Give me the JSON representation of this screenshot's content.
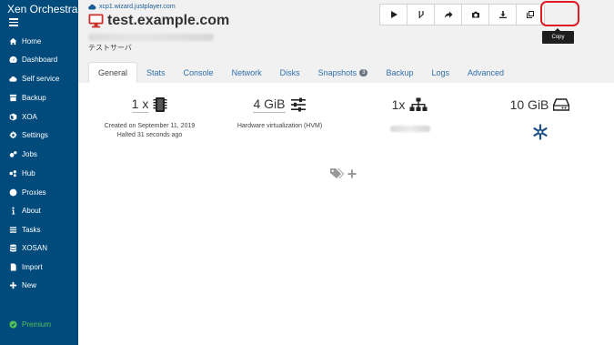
{
  "sidebar": {
    "brand": "Xen Orchestra",
    "items": [
      {
        "label": "Home",
        "icon": "home-icon"
      },
      {
        "label": "Dashboard",
        "icon": "dashboard-icon"
      },
      {
        "label": "Self service",
        "icon": "cloud-icon"
      },
      {
        "label": "Backup",
        "icon": "backup-icon"
      },
      {
        "label": "XOA",
        "icon": "cube-icon"
      },
      {
        "label": "Settings",
        "icon": "cog-icon"
      },
      {
        "label": "Jobs",
        "icon": "cogs-icon"
      },
      {
        "label": "Hub",
        "icon": "hub-icon"
      },
      {
        "label": "Proxies",
        "icon": "globe-icon"
      },
      {
        "label": "About",
        "icon": "info-icon"
      },
      {
        "label": "Tasks",
        "icon": "tasks-icon"
      },
      {
        "label": "XOSAN",
        "icon": "database-icon"
      },
      {
        "label": "Import",
        "icon": "import-icon"
      },
      {
        "label": "New",
        "icon": "plus-icon"
      }
    ],
    "premium": "Premium"
  },
  "header": {
    "host": "xcp1.wizard.justplayer.com",
    "vm_name": "test.example.com",
    "description": "テストサーバ",
    "actions": [
      "start-icon",
      "fast-clone-icon",
      "migrate-icon",
      "snapshot-icon",
      "export-icon",
      "copy-icon"
    ],
    "tooltip": "Copy"
  },
  "tabs": [
    {
      "label": "General",
      "active": true
    },
    {
      "label": "Stats"
    },
    {
      "label": "Console"
    },
    {
      "label": "Network"
    },
    {
      "label": "Disks"
    },
    {
      "label": "Snapshots",
      "badge": "3"
    },
    {
      "label": "Backup"
    },
    {
      "label": "Logs"
    },
    {
      "label": "Advanced"
    }
  ],
  "general": {
    "cpu": "1 x",
    "memory": "4 GiB",
    "network": "1x",
    "disk": "10 GiB",
    "created": "Created on September 11, 2019",
    "halted": "Halted 31 seconds ago",
    "virtualization": "Hardware virtualization (HVM)"
  },
  "colors": {
    "sidebar": "#004a7c",
    "accent": "#2f6fab",
    "vm_halted": "#c9302c",
    "premium": "#55c254",
    "highlight": "#e01b24"
  }
}
